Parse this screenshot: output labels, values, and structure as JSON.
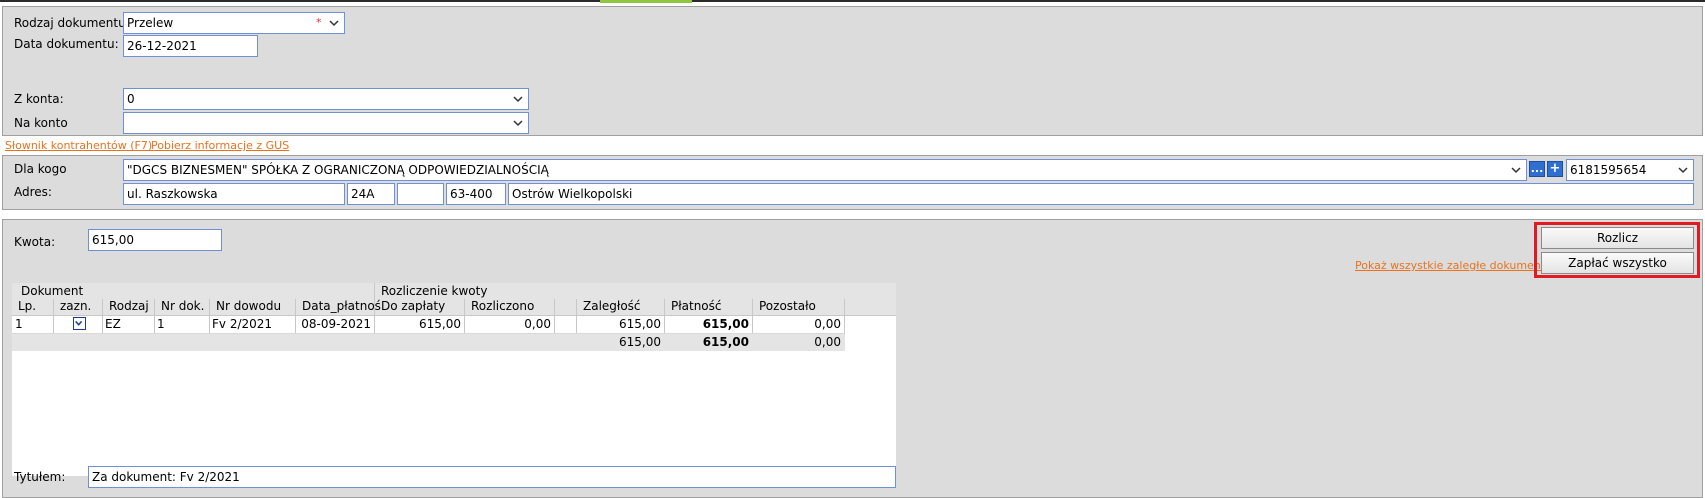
{
  "header": {
    "doc_type_label": "Rodzaj dokumentu:",
    "doc_type_value": "Przelew",
    "required_mark": "*",
    "doc_date_label": "Data dokumentu:",
    "doc_date_value": "26-12-2021",
    "from_account_label": "Z konta:",
    "from_account_value": "0",
    "to_account_label": "Na konto",
    "to_account_value": ""
  },
  "links": {
    "contractors": "Słownik kontrahentów (F7)",
    "gus": "Pobierz informacje z GUS",
    "show_overdue": "Pokaż wszystkie zaległe dokumenty"
  },
  "contractor": {
    "for_label": "Dla kogo",
    "for_value": "\"DGCS BIZNESMEN\" SPÓŁKA Z OGRANICZONĄ ODPOWIEDZIALNOŚCIĄ",
    "dots_button": "...",
    "add_button": "+",
    "nip_value": "6181595654",
    "address_label": "Adres:",
    "street": "ul. Raszkowska",
    "house_no": "24A",
    "flat_no": "",
    "postal_code": "63-400",
    "city": "Ostrów Wielkopolski"
  },
  "payment": {
    "amount_label": "Kwota:",
    "amount_value": "615,00",
    "settle_button": "Rozlicz",
    "pay_all_button": "Zapłać wszystko",
    "title_label": "Tytułem:",
    "title_value": "Za dokument: Fv 2/2021"
  },
  "table": {
    "group_document": "Dokument",
    "group_settlement": "Rozliczenie kwoty",
    "columns": [
      "Lp.",
      "zazn.",
      "Rodzaj",
      "Nr dok.",
      "Nr dowodu",
      "Data_płatnoś",
      "Do zapłaty",
      "Rozliczono",
      "",
      "Zaległość",
      "Płatność",
      "Pozostało"
    ],
    "rows": [
      [
        "1",
        "",
        "EZ",
        "1",
        "Fv 2/2021",
        "08-09-2021",
        "615,00",
        "0,00",
        "",
        "615,00",
        "615,00",
        "0,00"
      ]
    ],
    "totals": {
      "overdue": "615,00",
      "payment": "615,00",
      "remaining": "0,00"
    }
  },
  "colors": {
    "panel": "#dcdcdc",
    "field_border": "#6f8fd6",
    "link": "#e8731f",
    "highlight": "#e21b23",
    "accent_green": "#8ec63f"
  }
}
